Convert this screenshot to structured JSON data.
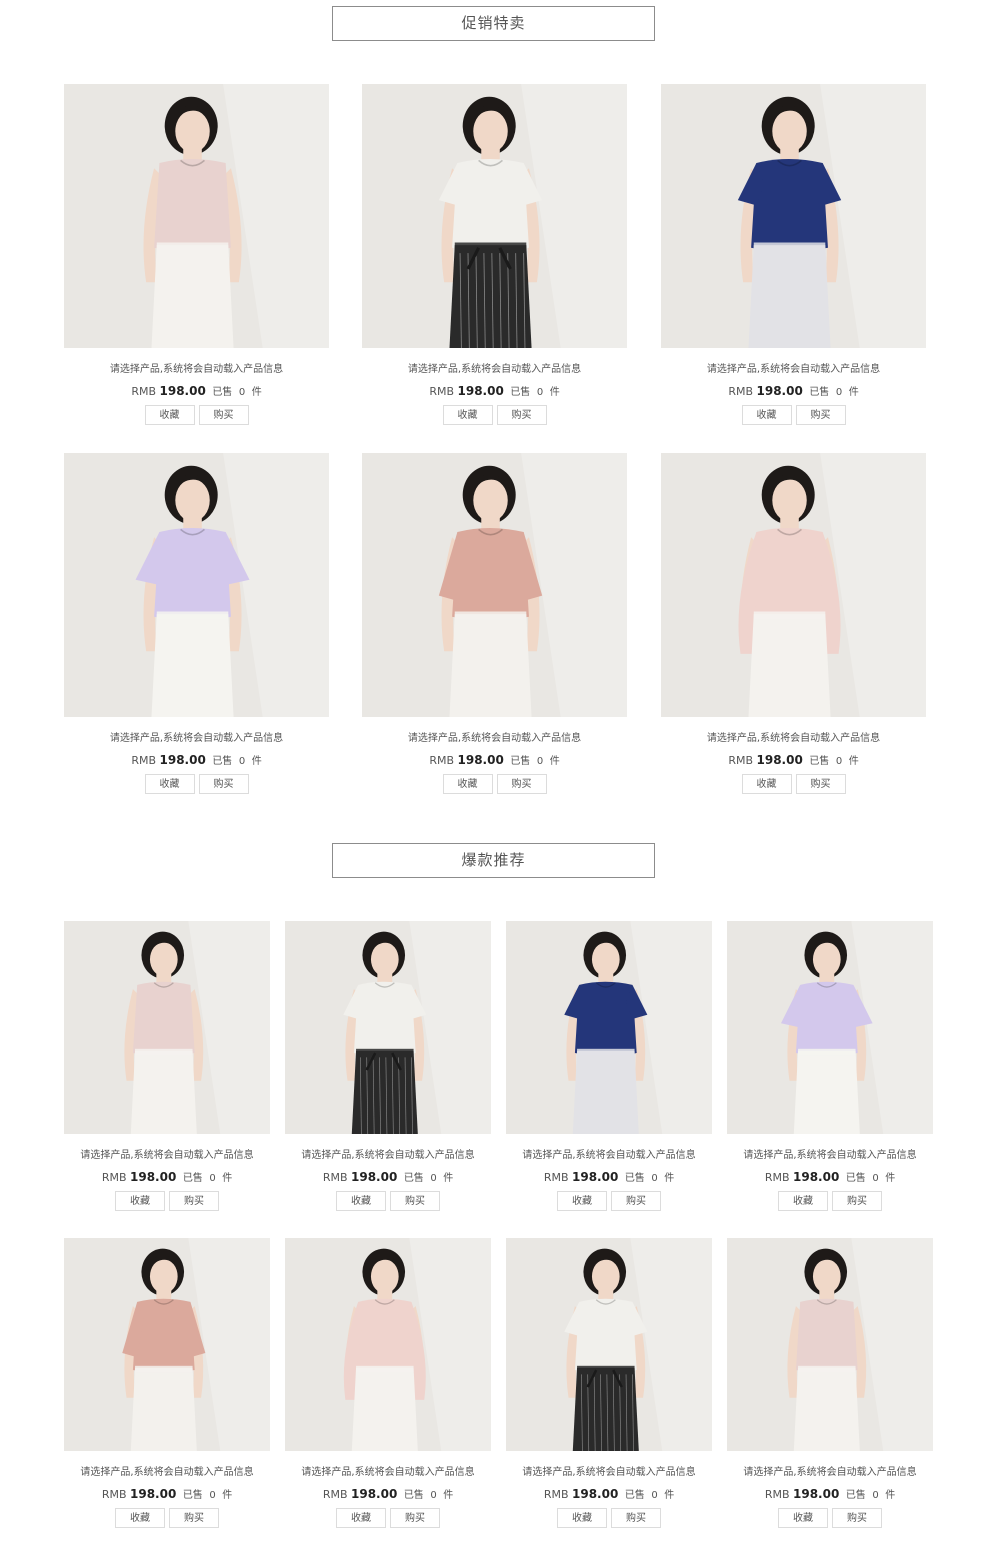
{
  "sections": [
    {
      "title": "促销特卖"
    },
    {
      "title": "爆款推荐"
    }
  ],
  "product": {
    "description": "请选择产品,系统将会自动载入产品信息",
    "currency": "RMB",
    "price": "198.00",
    "sold_label": "已售",
    "sold_count": "0",
    "sold_unit": "件",
    "favorite_label": "收藏",
    "buy_label": "购买"
  },
  "outfits": {
    "pink-sleeveless-knit": {
      "top": "#e8d2cf",
      "bottom": "#f4f2ee",
      "sleeve": "none"
    },
    "white-raglan-tee": {
      "top": "#f1f0ec",
      "bottom": "#2a2a2a",
      "sleeve": "short"
    },
    "navy-tee": {
      "top": "#24367a",
      "bottom": "#e2e2e6",
      "sleeve": "short"
    },
    "lavender-blouse": {
      "top": "#d3c8ec",
      "bottom": "#f5f4f0",
      "sleeve": "puff"
    },
    "rose-ribbed-knit": {
      "top": "#dba99c",
      "bottom": "#f3f1ed",
      "sleeve": "half"
    },
    "blush-shirt": {
      "top": "#efd3cd",
      "bottom": "#f4f2ee",
      "sleeve": "long"
    }
  },
  "promo_items": [
    {
      "outfit": "pink-sleeveless-knit"
    },
    {
      "outfit": "white-raglan-tee"
    },
    {
      "outfit": "navy-tee"
    },
    {
      "outfit": "lavender-blouse"
    },
    {
      "outfit": "rose-ribbed-knit"
    },
    {
      "outfit": "blush-shirt"
    }
  ],
  "hot_items": [
    {
      "outfit": "pink-sleeveless-knit"
    },
    {
      "outfit": "white-raglan-tee"
    },
    {
      "outfit": "navy-tee"
    },
    {
      "outfit": "lavender-blouse"
    },
    {
      "outfit": "rose-ribbed-knit"
    },
    {
      "outfit": "blush-shirt"
    },
    {
      "outfit": "white-raglan-tee"
    },
    {
      "outfit": "pink-sleeveless-knit"
    }
  ],
  "photo_background": "#e9e7e3",
  "skin_color": "#f0d8c8",
  "hair_color": "#1e1a18"
}
